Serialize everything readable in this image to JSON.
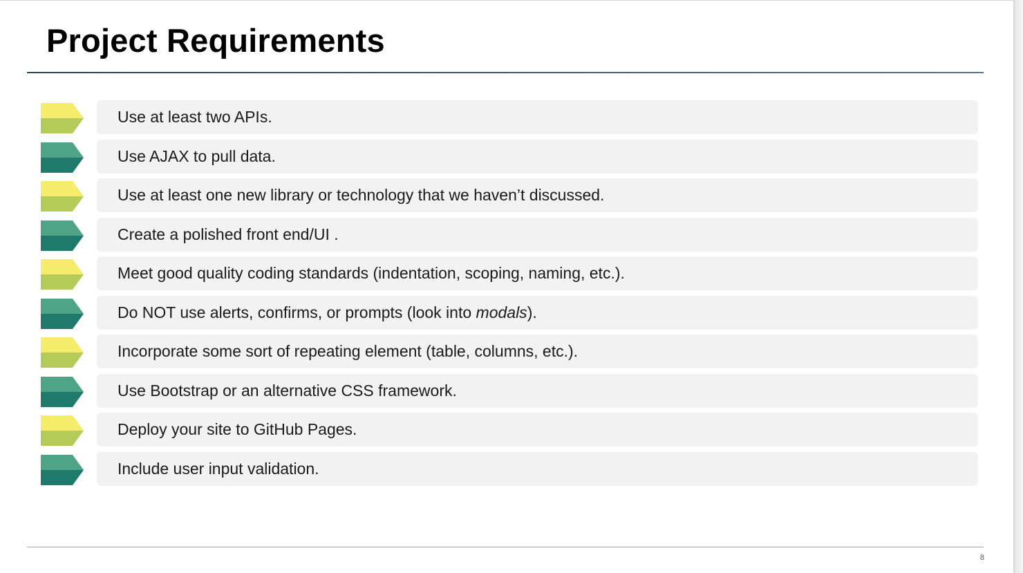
{
  "slide": {
    "title": "Project Requirements",
    "page_number": "8"
  },
  "colors": {
    "marker_yellow_top": "#f5ec6b",
    "marker_yellow_bottom": "#b4cb5a",
    "marker_green_top": "#4fa487",
    "marker_green_bottom": "#1f7a6c",
    "box_background": "#f2f2f2",
    "rule": "#2f4252"
  },
  "requirements": [
    {
      "text": "Use at least two APIs.",
      "marker": "yellow"
    },
    {
      "text": "Use AJAX to pull data.",
      "marker": "green"
    },
    {
      "text": "Use at least one new library or technology that we haven’t discussed.",
      "marker": "yellow"
    },
    {
      "text": "Create a polished front end/UI .",
      "marker": "green"
    },
    {
      "text": "Meet good quality coding standards (indentation, scoping, naming, etc.).",
      "marker": "yellow"
    },
    {
      "text_before": "Do NOT use alerts, confirms, or prompts (look into ",
      "text_em": "modals",
      "text_after": ").",
      "marker": "green"
    },
    {
      "text": "Incorporate some sort of repeating element (table, columns, etc.).",
      "marker": "yellow"
    },
    {
      "text": "Use Bootstrap or an alternative CSS framework.",
      "marker": "green"
    },
    {
      "text": "Deploy your site to GitHub Pages.",
      "marker": "yellow"
    },
    {
      "text": "Include user input validation.",
      "marker": "green"
    }
  ]
}
